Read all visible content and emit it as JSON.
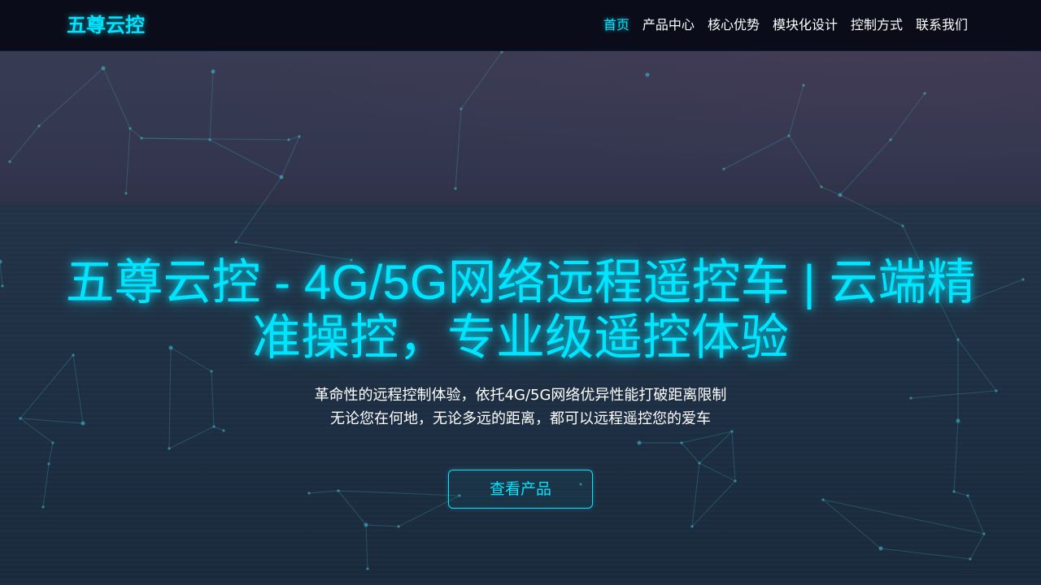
{
  "header": {
    "logo": "五尊云控",
    "nav": [
      {
        "label": "首页",
        "active": true
      },
      {
        "label": "产品中心",
        "active": false
      },
      {
        "label": "核心优势",
        "active": false
      },
      {
        "label": "模块化设计",
        "active": false
      },
      {
        "label": "控制方式",
        "active": false
      },
      {
        "label": "联系我们",
        "active": false
      }
    ]
  },
  "hero": {
    "title": "五尊云控 - 4G/5G网络远程遥控车 | 云端精准操控，专业级遥控体验",
    "subtitle_lines": [
      "革命性的远程控制体验，依托4G/5G网络优异性能打破距离限制",
      "无论您在何地，无论多远的距离，都可以远程遥控您的爱车"
    ],
    "cta_label": "查看产品"
  },
  "colors": {
    "accent": "#00e5ff",
    "navbar_bg": "#080914",
    "text": "#ffffff"
  }
}
